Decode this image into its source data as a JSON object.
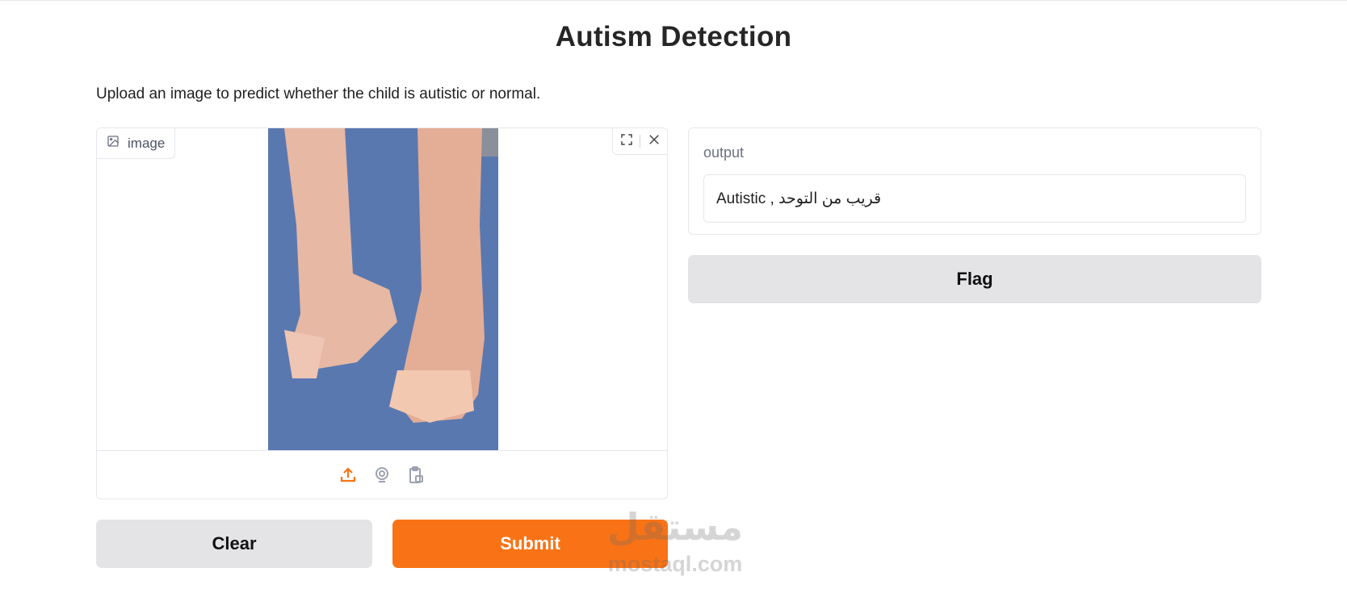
{
  "header": {
    "title": "Autism Detection",
    "description": "Upload an image to predict whether the child is autistic or normal."
  },
  "image_input": {
    "label": "image",
    "label_icon": "image-icon",
    "tools": [
      "fullscreen-icon",
      "close-icon"
    ],
    "sources": [
      "upload-icon",
      "webcam-icon",
      "clipboard-icon"
    ],
    "active_source_color": "#f97316"
  },
  "output": {
    "label": "output",
    "value": "Autistic , قريب من التوحد"
  },
  "buttons": {
    "flag": "Flag",
    "clear": "Clear",
    "submit": "Submit"
  },
  "watermark": {
    "arabic": "مستقل",
    "latin": "mostaql.com"
  },
  "colors": {
    "accent": "#f97316",
    "secondary_button": "#e4e4e7",
    "border": "#e5e7eb"
  }
}
